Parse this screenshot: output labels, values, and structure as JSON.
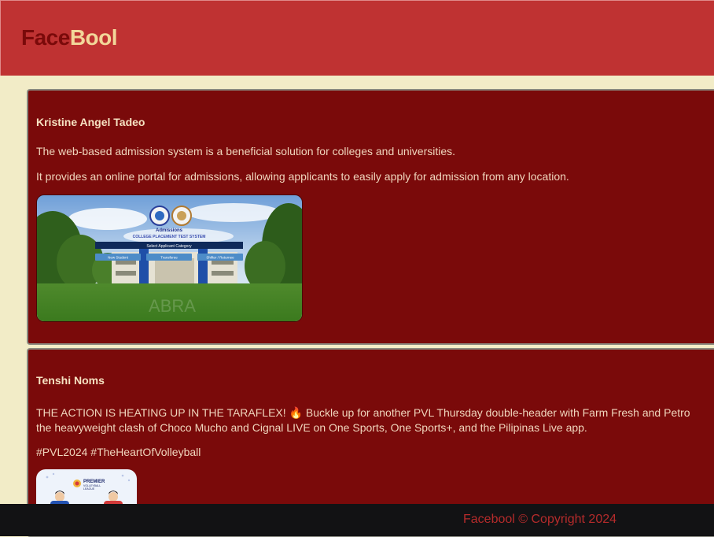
{
  "brand": {
    "part1": "Face",
    "part2": "Bool"
  },
  "posts": [
    {
      "author": "Kristine Angel Tadeo",
      "lines": [
        "The web-based admission system is a beneficial solution for colleges and universities.",
        "It provides an online portal for admissions, allowing applicants to easily apply for admission from any location."
      ],
      "image": {
        "heading": "Admissions",
        "subheading": "COLLEGE PLACEMENT TEST SYSTEM",
        "bar": "Select Applicant Category",
        "buttons": [
          "New Student",
          "Transferee",
          "Shifter / Returnee"
        ],
        "watermark": "ABRA"
      }
    },
    {
      "author": "Tenshi Noms",
      "lines": [
        "THE ACTION IS HEATING UP IN THE TARAFLEX! 🔥 Buckle up for another PVL Thursday double-header with Farm Fresh and Petro",
        "the heavyweight clash of Choco Mucho and Cignal LIVE on One Sports, One Sports+, and the Pilipinas Live app.",
        "#PVL2024 #TheHeartOfVolleyball"
      ],
      "image": {
        "title_line1": "PREMIER",
        "title_line2": "VOLLEYBALL",
        "title_line3": "LEAGUE"
      }
    }
  ],
  "footer": {
    "copyright": "Facebool © Copyright 2024"
  },
  "colors": {
    "header": "#bf3232",
    "post_bg": "#7a0a0a",
    "page_bg": "#f2ecc7",
    "footer_bg": "#121214"
  }
}
